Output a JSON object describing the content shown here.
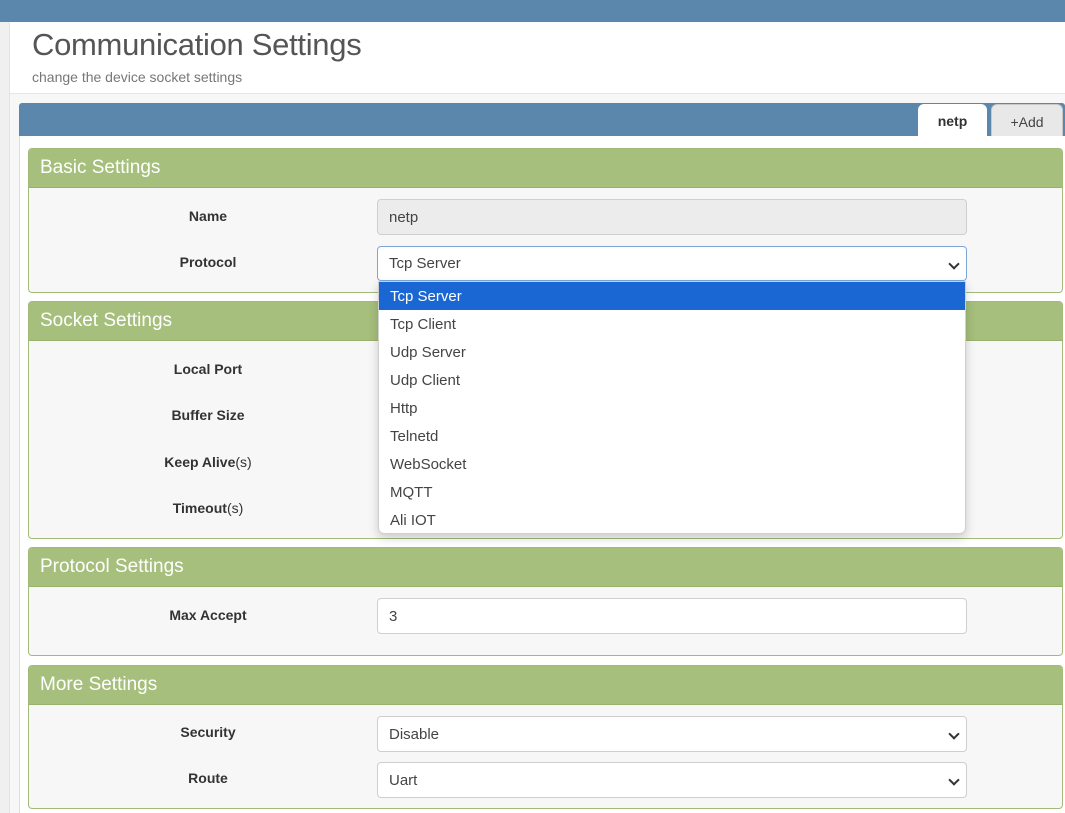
{
  "header": {
    "title": "Communication Settings",
    "subtitle": "change the device socket settings"
  },
  "tabs": [
    {
      "label": "netp",
      "active": true
    },
    {
      "label": "+Add",
      "active": false
    }
  ],
  "basic": {
    "heading": "Basic Settings",
    "name_label": "Name",
    "name_value": "netp",
    "protocol_label": "Protocol",
    "protocol_value": "Tcp Server",
    "protocol_options": [
      "Tcp Server",
      "Tcp Client",
      "Udp Server",
      "Udp Client",
      "Http",
      "Telnetd",
      "WebSocket",
      "MQTT",
      "Ali IOT"
    ]
  },
  "socket": {
    "heading": "Socket Settings",
    "local_port_label": "Local Port",
    "buffer_size_label": "Buffer Size",
    "keep_alive_label": "Keep Alive",
    "keep_alive_unit": "(s)",
    "timeout_label": "Timeout",
    "timeout_unit": "(s)"
  },
  "protocol_settings": {
    "heading": "Protocol Settings",
    "max_accept_label": "Max Accept",
    "max_accept_value": "3"
  },
  "more": {
    "heading": "More Settings",
    "security_label": "Security",
    "security_value": "Disable",
    "route_label": "Route",
    "route_value": "Uart"
  },
  "colors": {
    "topbar": "#5b87ad",
    "panel_header": "#a6bf7c",
    "dropdown_selected": "#1a66d2"
  }
}
